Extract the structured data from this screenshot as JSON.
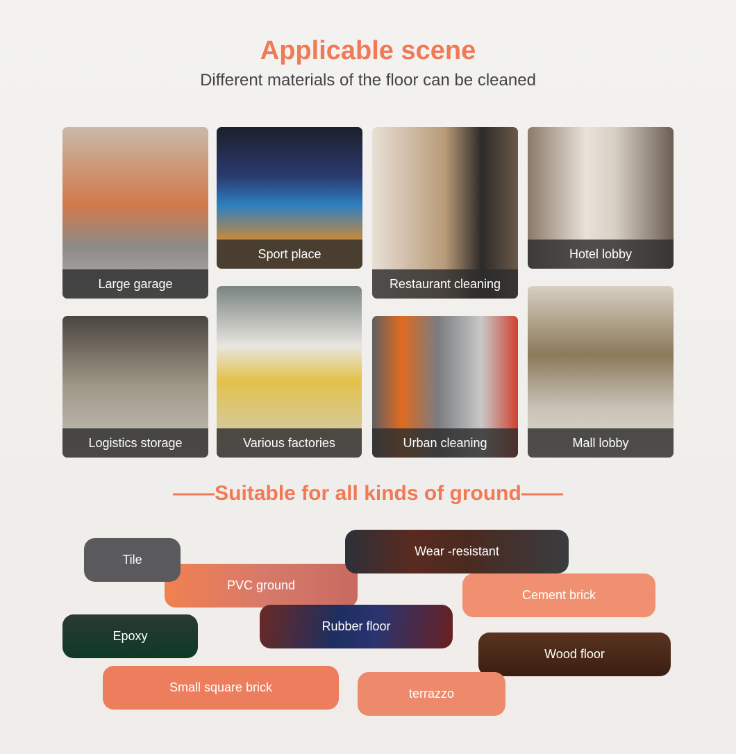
{
  "header": {
    "title": "Applicable scene",
    "subtitle": "Different materials of the floor can be cleaned"
  },
  "scenes": [
    {
      "label": "Large garage"
    },
    {
      "label": "Sport place"
    },
    {
      "label": "Restaurant  cleaning"
    },
    {
      "label": "Hotel lobby"
    },
    {
      "label": "Logistics storage"
    },
    {
      "label": "Various factories"
    },
    {
      "label": "Urban cleaning"
    },
    {
      "label": "Mall lobby"
    }
  ],
  "ground": {
    "title": "——Suitable for all kinds of ground——",
    "items": [
      {
        "label": "Tile"
      },
      {
        "label": "PVC ground"
      },
      {
        "label": "Wear -resistant"
      },
      {
        "label": "Cement brick"
      },
      {
        "label": "Epoxy"
      },
      {
        "label": "Rubber floor"
      },
      {
        "label": "Wood floor"
      },
      {
        "label": "Small square brick"
      },
      {
        "label": "terrazzo"
      }
    ]
  },
  "colors": {
    "accent": "#ef7a55"
  }
}
